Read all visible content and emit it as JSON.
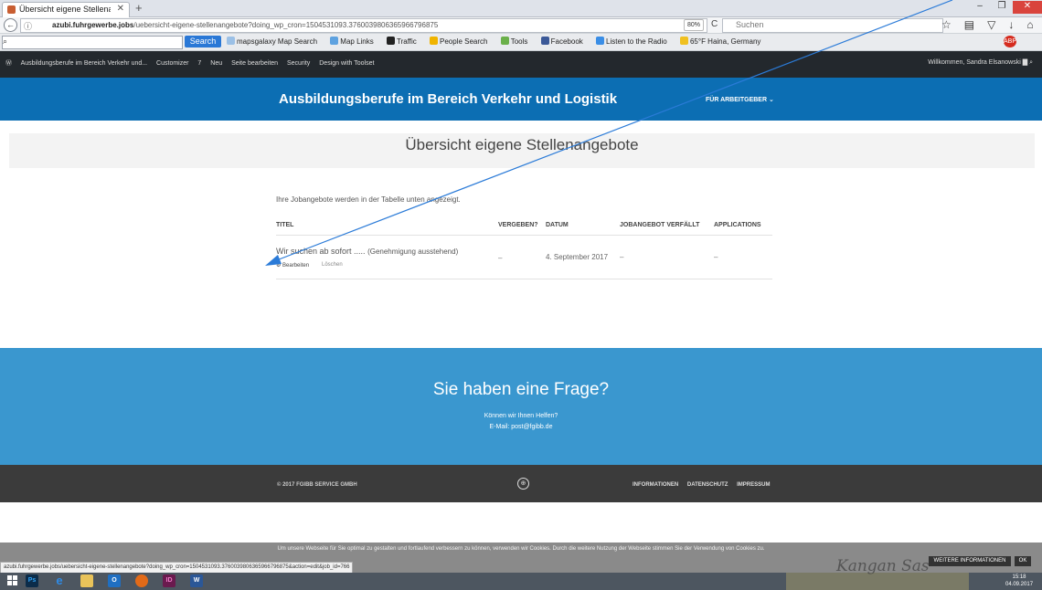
{
  "browser": {
    "tab_title": "Übersicht eigene Stellenang",
    "url_domain": "azubi.fuhrgewerbe.jobs",
    "url_path": "/uebersicht-eigene-stellenangebote?doing_wp_cron=1504531093.3760039806365966796875",
    "zoom": "80%",
    "search_placeholder": "Suchen"
  },
  "toolbar": {
    "search_button": "Search",
    "items": [
      "mapsgalaxy Map Search",
      "Map Links",
      "Traffic",
      "People Search",
      "Tools",
      "Facebook",
      "Listen to the Radio",
      "65°F Haina, Germany"
    ]
  },
  "adminbar": {
    "items": [
      "Ausbildungsberufe im Bereich Verkehr und...",
      "Customizer",
      "7",
      "Neu",
      "Seite bearbeiten",
      "Security",
      "Design with Toolset"
    ],
    "welcome": "Willkommen, Sandra Elsanowski"
  },
  "site": {
    "title": "Ausbildungsberufe im Bereich Verkehr und Logistik",
    "nav_employer": "FÜR ARBEITGEBER ⌄",
    "page_title": "Übersicht eigene Stellenangebote",
    "intro": "Ihre Jobangebote werden in der Tabelle unten angezeigt."
  },
  "table": {
    "headers": [
      "TITEL",
      "VERGEBEN?",
      "DATUM",
      "JOBANGEBOT VERFÄLLT",
      "APPLICATIONS"
    ],
    "row": {
      "title": "Wir suchen ab sofort .....",
      "status": "(Genehmigung ausstehend)",
      "edit": "Bearbeiten",
      "delete": "Löschen",
      "vergeben": "–",
      "date": "4. September 2017",
      "expires": "–",
      "applications": "–"
    }
  },
  "question": {
    "title": "Sie haben eine Frage?",
    "help": "Können wir Ihnen Helfen?",
    "mail": "E-Mail: post@fgibb.de"
  },
  "footer": {
    "copyright": "© 2017 FGIBB SERVICE GMBH",
    "links": [
      "INFORMATIONEN",
      "DATENSCHUTZ",
      "IMPRESSUM"
    ]
  },
  "cookie": {
    "text": "Um unsere Webseite für Sie optimal zu gestalten und fortlaufend verbessern zu können, verwenden wir Cookies. Durch die weitere Nutzung der Webseite stimmen Sie der Verwendung von Cookies zu.",
    "more": "WEITERE INFORMATIONEN",
    "ok": "OK"
  },
  "status_url": "azubi.fuhrgewerbe.jobs/uebersicht-eigene-stellenangebote?doing_wp_cron=1504531093.3760039806365966796875&action=edit&job_id=766",
  "taskbar": {
    "apps": [
      "Ps",
      "e",
      "",
      "O",
      "",
      "ID",
      "W"
    ],
    "signature": "Kangan Sas",
    "time": "15:18",
    "date": "04.09.2017"
  },
  "colors": {
    "header": "#0c6eb3",
    "question_bg": "#3a97cf",
    "footer_bg": "#3b3b3b",
    "annotation_arrow": "#2b7bd8"
  }
}
